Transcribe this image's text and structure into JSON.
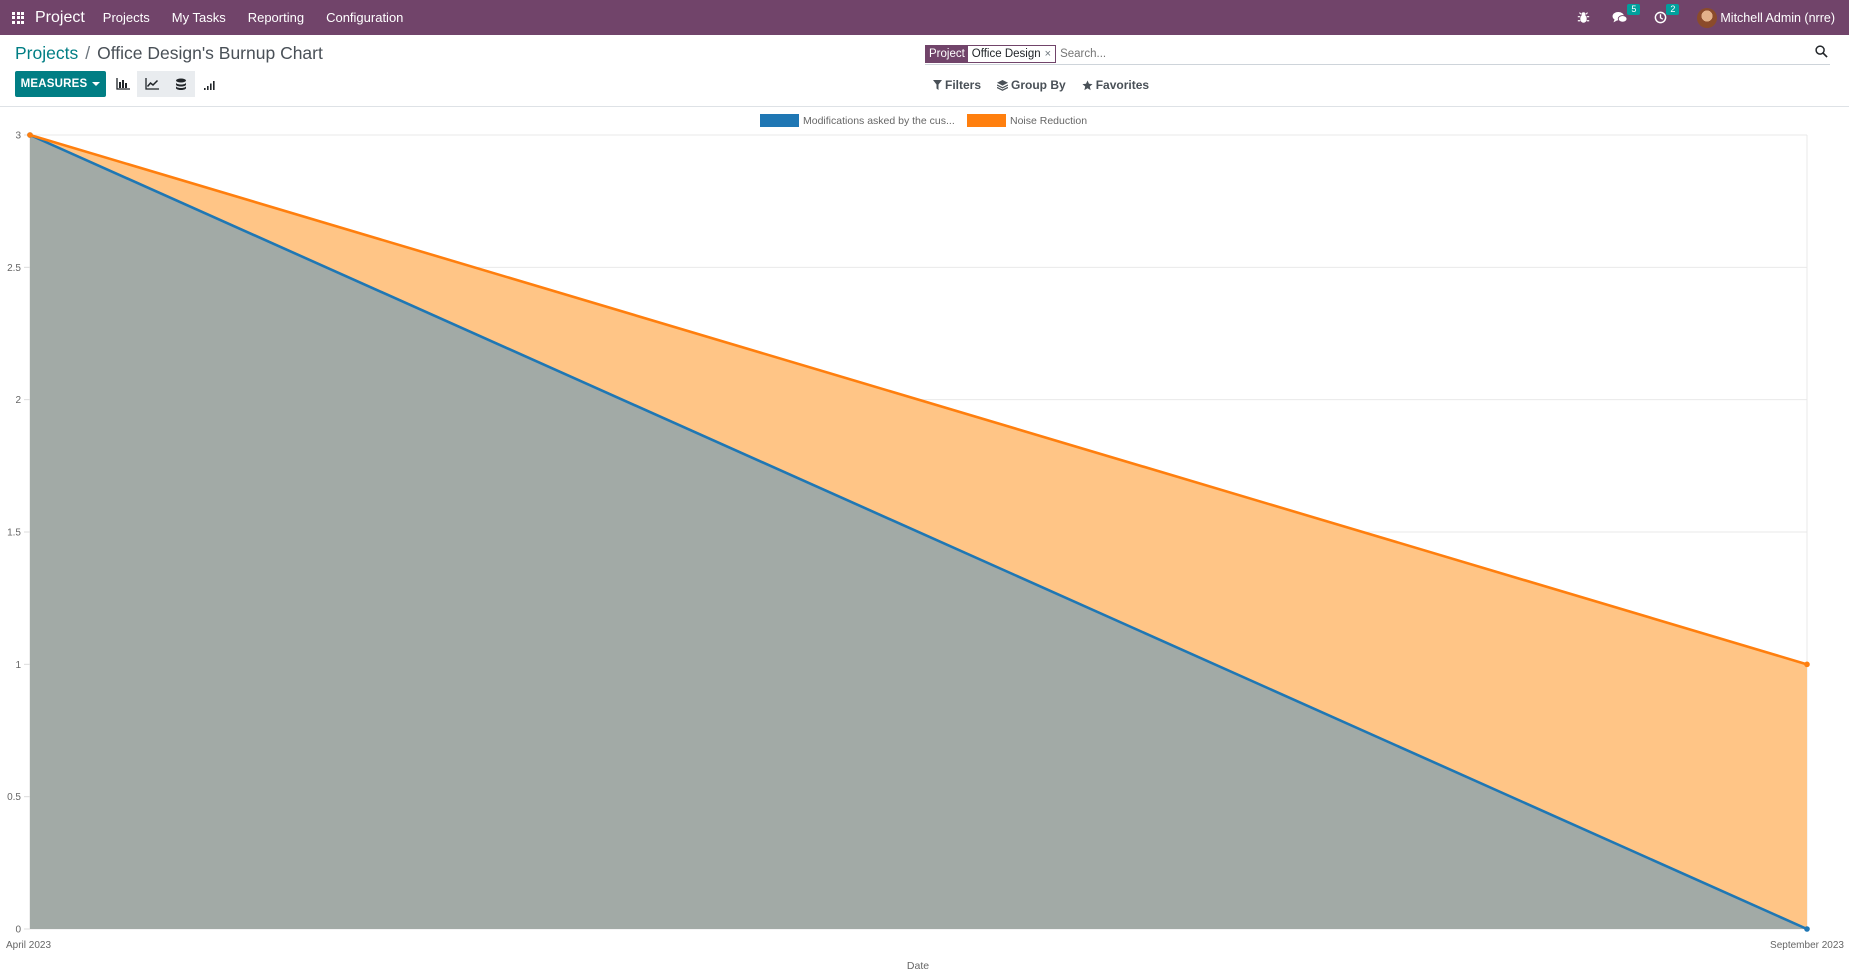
{
  "navbar": {
    "app_name": "Project",
    "menu": [
      "Projects",
      "My Tasks",
      "Reporting",
      "Configuration"
    ],
    "messages_count": "5",
    "activities_count": "2",
    "user_name": "Mitchell Admin (nrre)"
  },
  "breadcrumb": {
    "parent": "Projects",
    "separator": "/",
    "current": "Office Design's Burnup Chart"
  },
  "toolbar": {
    "measures_label": "MEASURES",
    "views": [
      "bar-chart-icon",
      "line-chart-icon",
      "stacked-icon",
      "descending-icon"
    ]
  },
  "search": {
    "facet_label": "Project",
    "facet_value": "Office Design",
    "facet_remove": "×",
    "placeholder": "Search..."
  },
  "filters": {
    "filters_label": "Filters",
    "groupby_label": "Group By",
    "favorites_label": "Favorites"
  },
  "colors": {
    "navbar": "#71446a",
    "accent": "#017e84",
    "series_1": "#1f77b4",
    "series_2": "#ff7f0e"
  },
  "chart_data": {
    "type": "area",
    "stacked": true,
    "xlabel": "Date",
    "ylabel": "",
    "categories": [
      "April 2023",
      "September 2023"
    ],
    "y_ticks": [
      "0",
      "0.5",
      "1",
      "1.5",
      "2",
      "2.5",
      "3"
    ],
    "ylim": [
      0,
      3
    ],
    "series": [
      {
        "name": "Modifications asked by the cus...",
        "values": [
          3,
          0
        ],
        "color": "#1f77b4",
        "fill": "#a2aaa6"
      },
      {
        "name": "Noise Reduction",
        "values": [
          0,
          1
        ],
        "color": "#ff7f0e",
        "fill": "#ffc586"
      }
    ],
    "legend": "top-center",
    "grid": true
  }
}
